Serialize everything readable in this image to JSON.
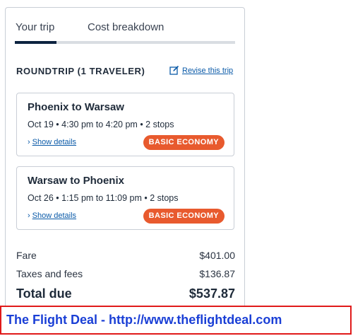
{
  "tabs": [
    {
      "label": "Your trip",
      "active": true
    },
    {
      "label": "Cost breakdown",
      "active": false
    }
  ],
  "trip": {
    "heading": "ROUNDTRIP (1 TRAVELER)",
    "revise_label": "Revise this trip"
  },
  "flights": [
    {
      "route": "Phoenix to Warsaw",
      "times": "Oct 19 • 4:30 pm to 4:20 pm • 2 stops",
      "details_label": "Show details",
      "fare_class": "BASIC ECONOMY"
    },
    {
      "route": "Warsaw to Phoenix",
      "times": "Oct 26 • 1:15 pm to 11:09 pm • 2 stops",
      "details_label": "Show details",
      "fare_class": "BASIC ECONOMY"
    }
  ],
  "costs": {
    "fare_label": "Fare",
    "fare_amount": "$401.00",
    "taxes_label": "Taxes and fees",
    "taxes_amount": "$136.87",
    "total_label": "Total due",
    "total_amount": "$537.87"
  },
  "banner": {
    "text": "The Flight Deal - http://www.theflightdeal.com"
  },
  "colors": {
    "accent": "#0c2340",
    "link": "#0a5aa8",
    "badge": "#e85a2e",
    "banner_border": "#e01a1a",
    "banner_text": "#1a3fd6"
  }
}
